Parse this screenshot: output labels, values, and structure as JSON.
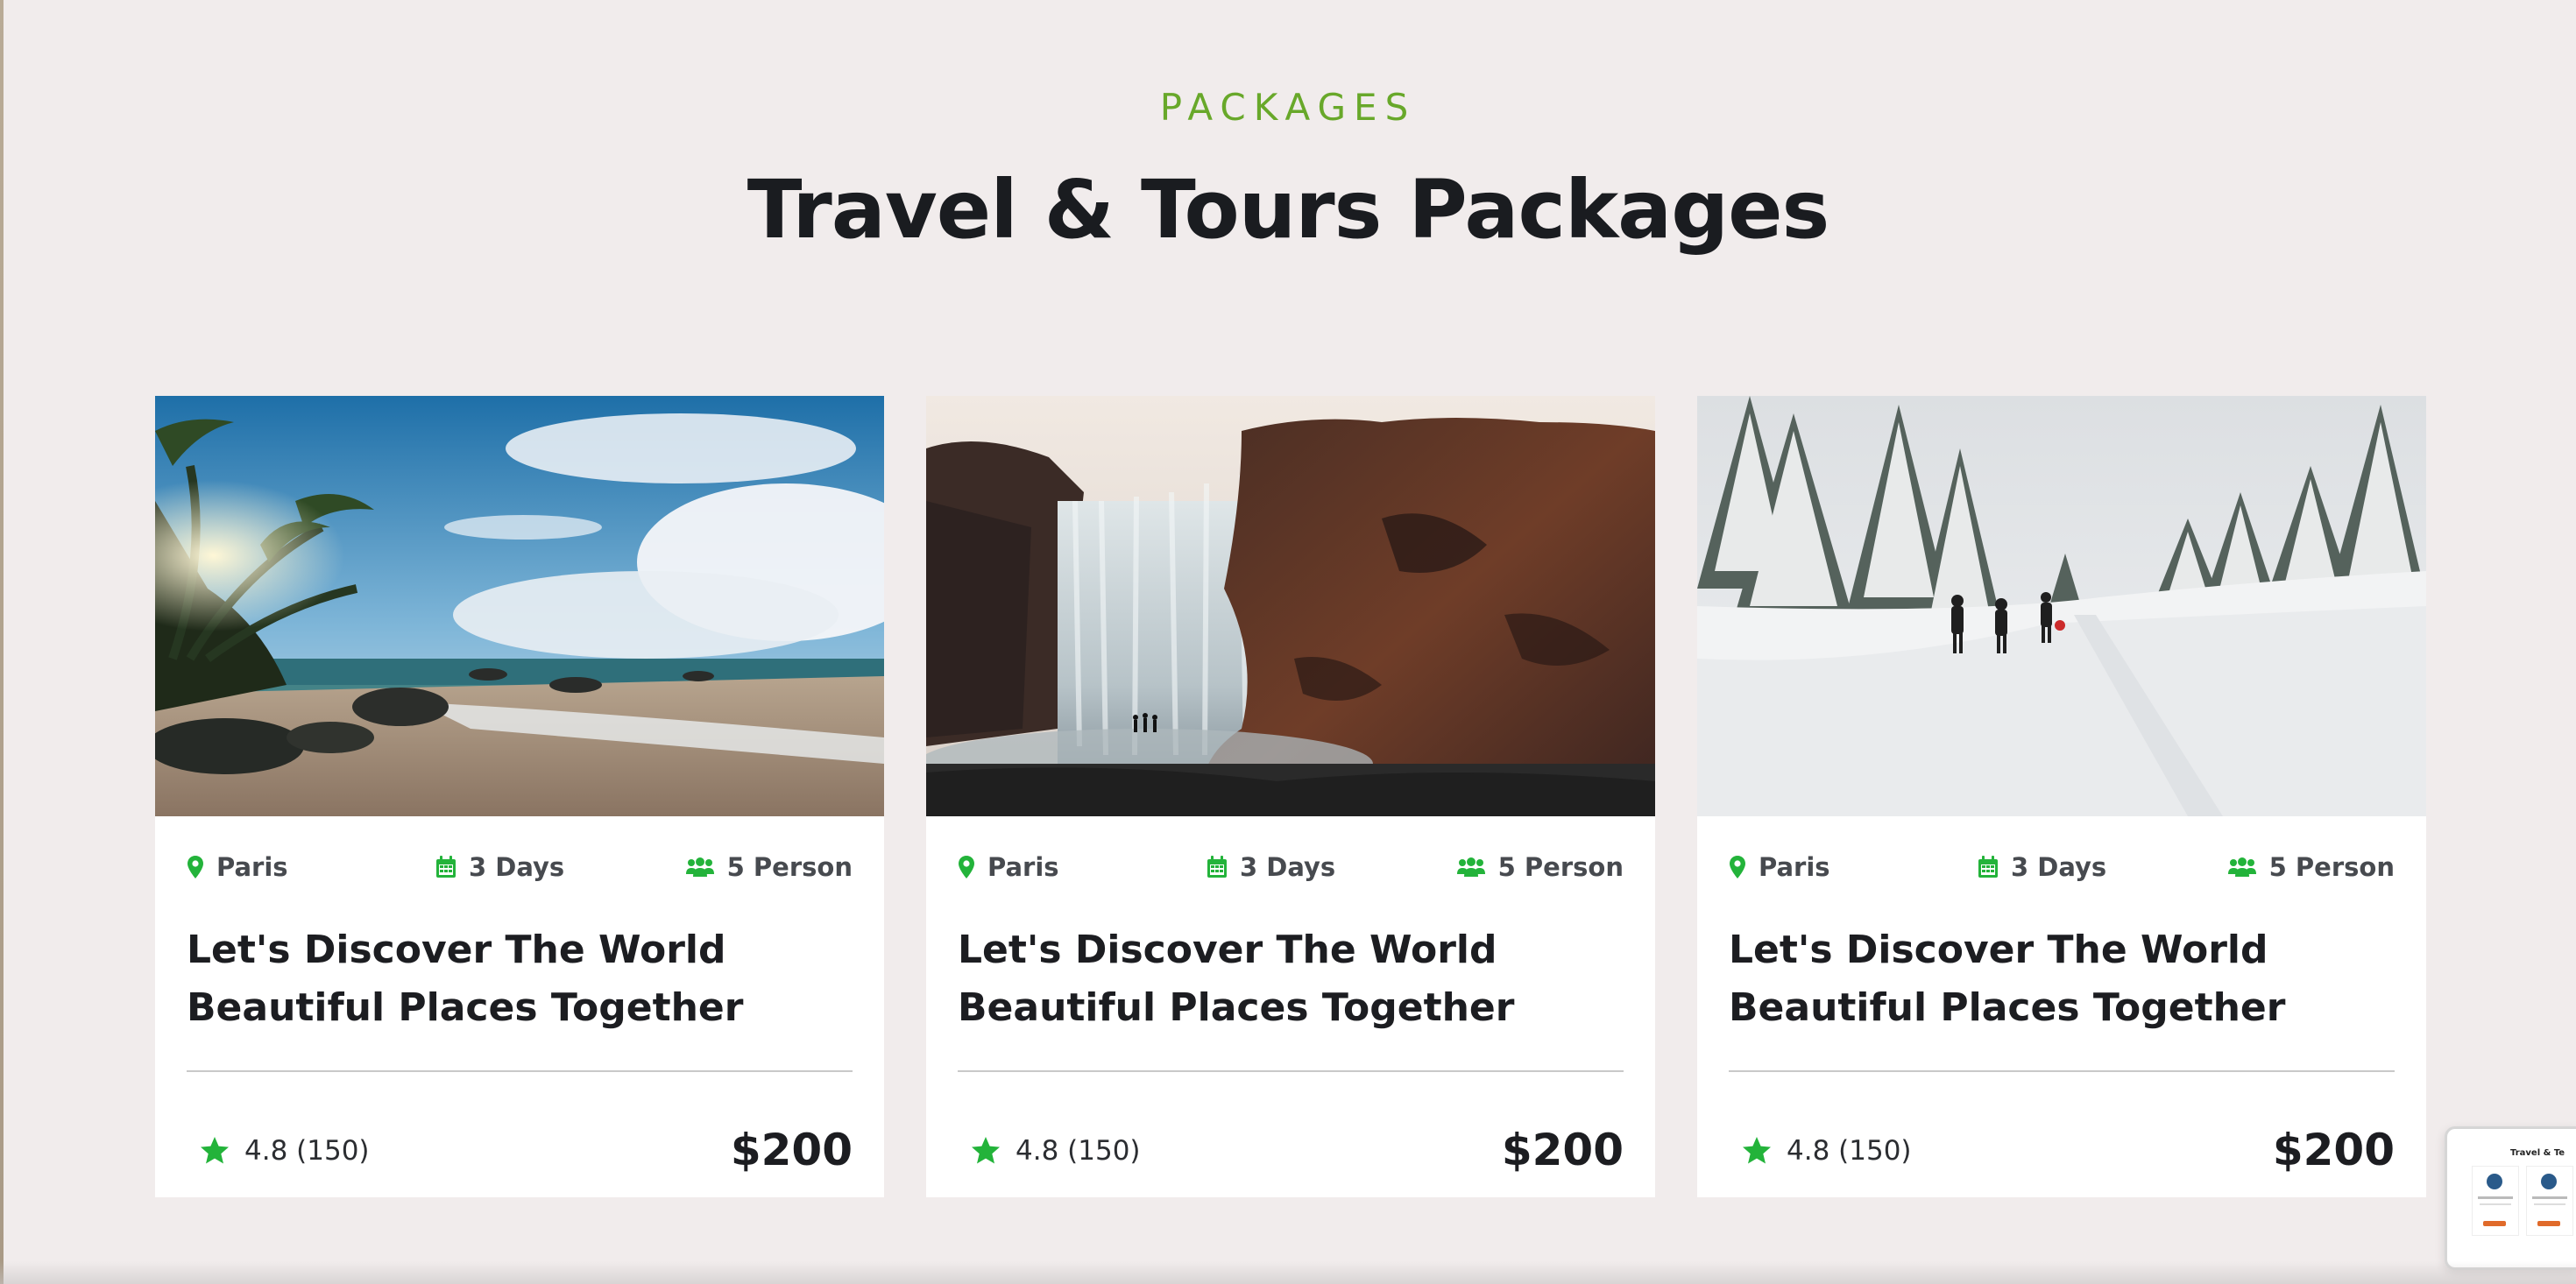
{
  "section": {
    "eyebrow": "PACKAGES",
    "title": "Travel & Tours Packages"
  },
  "colors": {
    "accent_green": "#68a82a",
    "icon_green": "#23b33a",
    "background": "#f1ecec"
  },
  "cards": [
    {
      "image": "beach-photo",
      "location": "Paris",
      "duration": "3 Days",
      "people": "5 Person",
      "title": "Let's Discover The World Beautiful Places Together",
      "rating": "4.8 (150)",
      "price": "$200"
    },
    {
      "image": "waterfall-photo",
      "location": "Paris",
      "duration": "3 Days",
      "people": "5 Person",
      "title": "Let's Discover The World Beautiful Places Together",
      "rating": "4.8 (150)",
      "price": "$200"
    },
    {
      "image": "snow-forest-photo",
      "location": "Paris",
      "duration": "3 Days",
      "people": "5 Person",
      "title": "Let's Discover The World Beautiful Places Together",
      "rating": "4.8 (150)",
      "price": "$200"
    }
  ],
  "mini_preview": {
    "title": "Travel & Te"
  },
  "icons": {
    "location": "map-pin-icon",
    "duration": "calendar-icon",
    "people": "users-icon",
    "rating": "star-icon"
  }
}
